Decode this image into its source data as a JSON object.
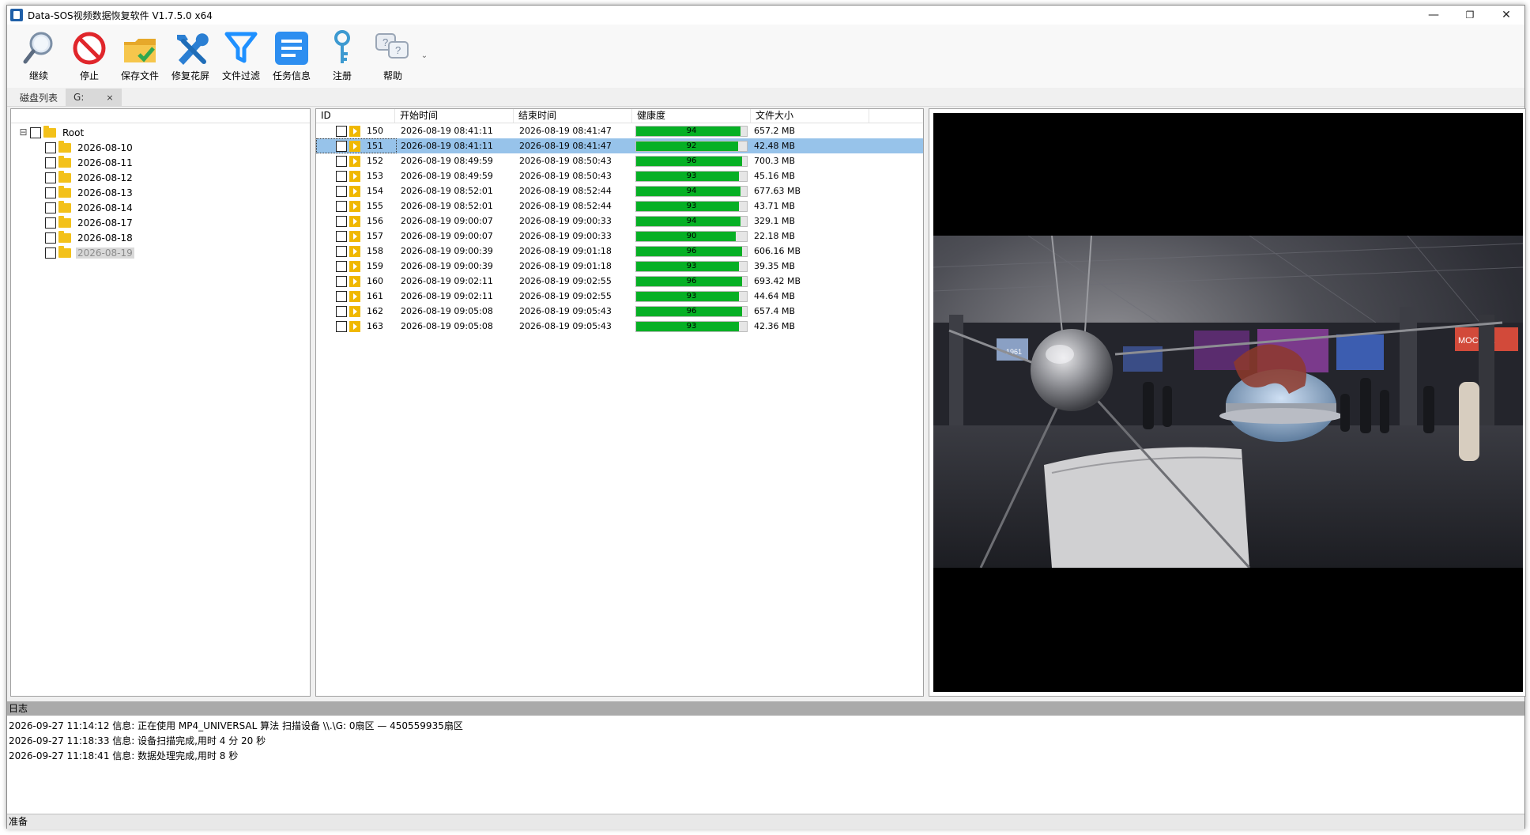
{
  "window": {
    "title": "Data-SOS视频数据恢复软件 V1.7.5.0 x64",
    "controls": {
      "minimize": "—",
      "restore": "❐",
      "close": "✕"
    }
  },
  "toolbar": {
    "items": [
      {
        "label": "继续",
        "icon": "magnifier-icon"
      },
      {
        "label": "停止",
        "icon": "stop-icon"
      },
      {
        "label": "保存文件",
        "icon": "save-folder-icon"
      },
      {
        "label": "修复花屏",
        "icon": "repair-tools-icon"
      },
      {
        "label": "文件过滤",
        "icon": "filter-icon"
      },
      {
        "label": "任务信息",
        "icon": "task-info-icon"
      },
      {
        "label": "注册",
        "icon": "key-icon"
      },
      {
        "label": "帮助",
        "icon": "help-bubbles-icon"
      }
    ],
    "more": "⌄"
  },
  "tabs": {
    "disk_list": "磁盘列表",
    "drive": "G:",
    "close": "×"
  },
  "tree": {
    "root": {
      "label": "Root",
      "expander": "⊟"
    },
    "children": [
      "2026-08-10",
      "2026-08-11",
      "2026-08-12",
      "2026-08-13",
      "2026-08-14",
      "2026-08-17",
      "2026-08-18",
      "2026-08-19"
    ],
    "selected": "2026-08-19"
  },
  "list": {
    "columns": {
      "id": "ID",
      "start": "开始时间",
      "end": "结束时间",
      "health": "健康度",
      "size": "文件大小"
    },
    "selected_id": "151",
    "rows": [
      {
        "id": "150",
        "start": "2026-08-19 08:41:11",
        "end": "2026-08-19 08:41:47",
        "health": 94,
        "size": "657.2 MB"
      },
      {
        "id": "151",
        "start": "2026-08-19 08:41:11",
        "end": "2026-08-19 08:41:47",
        "health": 92,
        "size": "42.48 MB"
      },
      {
        "id": "152",
        "start": "2026-08-19 08:49:59",
        "end": "2026-08-19 08:50:43",
        "health": 96,
        "size": "700.3 MB"
      },
      {
        "id": "153",
        "start": "2026-08-19 08:49:59",
        "end": "2026-08-19 08:50:43",
        "health": 93,
        "size": "45.16 MB"
      },
      {
        "id": "154",
        "start": "2026-08-19 08:52:01",
        "end": "2026-08-19 08:52:44",
        "health": 94,
        "size": "677.63 MB"
      },
      {
        "id": "155",
        "start": "2026-08-19 08:52:01",
        "end": "2026-08-19 08:52:44",
        "health": 93,
        "size": "43.71 MB"
      },
      {
        "id": "156",
        "start": "2026-08-19 09:00:07",
        "end": "2026-08-19 09:00:33",
        "health": 94,
        "size": "329.1 MB"
      },
      {
        "id": "157",
        "start": "2026-08-19 09:00:07",
        "end": "2026-08-19 09:00:33",
        "health": 90,
        "size": "22.18 MB"
      },
      {
        "id": "158",
        "start": "2026-08-19 09:00:39",
        "end": "2026-08-19 09:01:18",
        "health": 96,
        "size": "606.16 MB"
      },
      {
        "id": "159",
        "start": "2026-08-19 09:00:39",
        "end": "2026-08-19 09:01:18",
        "health": 93,
        "size": "39.35 MB"
      },
      {
        "id": "160",
        "start": "2026-08-19 09:02:11",
        "end": "2026-08-19 09:02:55",
        "health": 96,
        "size": "693.42 MB"
      },
      {
        "id": "161",
        "start": "2026-08-19 09:02:11",
        "end": "2026-08-19 09:02:55",
        "health": 93,
        "size": "44.64 MB"
      },
      {
        "id": "162",
        "start": "2026-08-19 09:05:08",
        "end": "2026-08-19 09:05:43",
        "health": 96,
        "size": "657.4 MB"
      },
      {
        "id": "163",
        "start": "2026-08-19 09:05:08",
        "end": "2026-08-19 09:05:43",
        "health": 93,
        "size": "42.36 MB"
      }
    ]
  },
  "preview": {
    "description_icon": "video-preview",
    "sign_text": "МОСКВА",
    "sign_text_2": "1961"
  },
  "log": {
    "header": "日志",
    "lines": [
      "2026-09-27 11:14:12 信息: 正在使用 MP4_UNIVERSAL 算法 扫描设备 \\\\.\\G: 0扇区 — 450559935扇区",
      "2026-09-27 11:18:33 信息: 设备扫描完成,用时 4 分 20 秒",
      "2026-09-27 11:18:41 信息: 数据处理完成,用时 8 秒"
    ]
  },
  "status": {
    "text": "准备"
  },
  "colors": {
    "health_fill": "#06b025",
    "selection": "#97c3ea",
    "folder": "#f3c11a"
  }
}
